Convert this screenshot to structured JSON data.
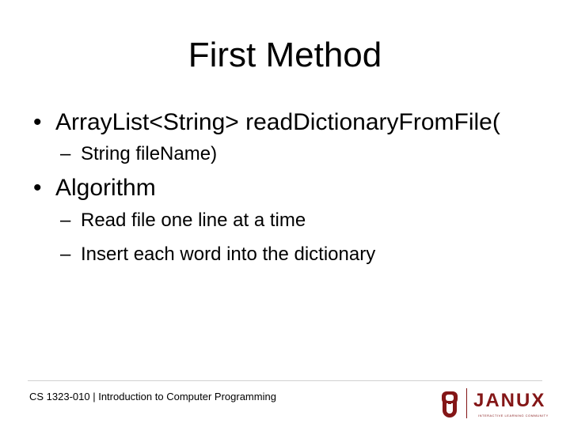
{
  "slide": {
    "title": "First Method",
    "bullets": [
      {
        "marker": "•",
        "text": "ArrayList<String> readDictionaryFromFile(",
        "subitems": [
          {
            "marker": "–",
            "text": "String fileName)"
          }
        ]
      },
      {
        "marker": "•",
        "text": "Algorithm",
        "subitems": [
          {
            "marker": "–",
            "text": "Read file one line at a time"
          },
          {
            "marker": "–",
            "text": "Insert each word into the dictionary"
          }
        ]
      }
    ]
  },
  "footer": {
    "course_text": "CS 1323-010 | Introduction to Computer Programming",
    "logo_name": "JANUX",
    "logo_tagline": "INTERACTIVE LEARNING COMMUNITY",
    "ou_logo_icon": "ou-monogram-icon",
    "brand_color": "#841617"
  }
}
